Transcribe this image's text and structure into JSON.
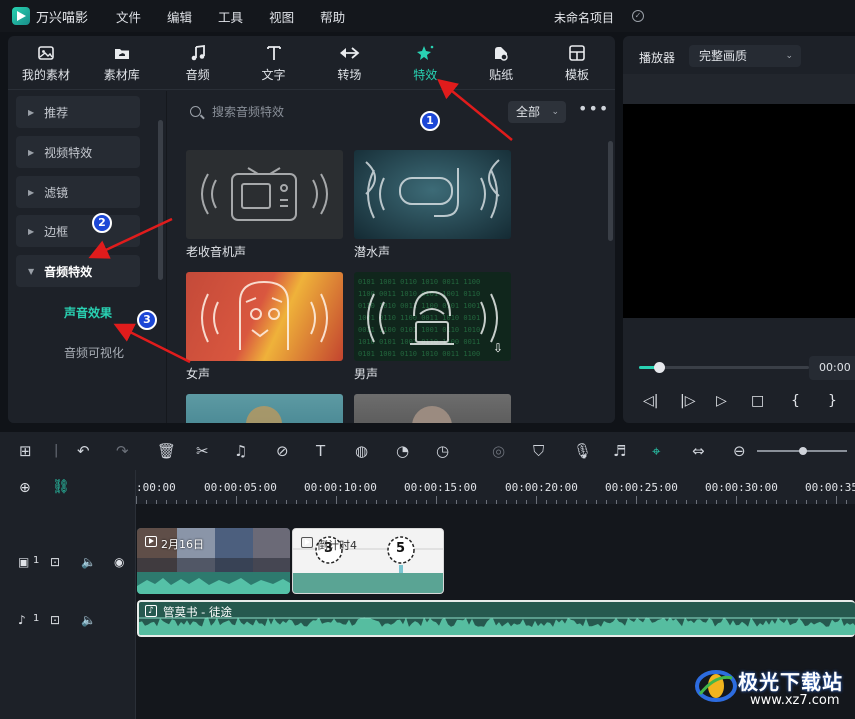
{
  "app": {
    "name": "万兴喵影",
    "project_name": "未命名项目"
  },
  "menu": [
    "文件",
    "编辑",
    "工具",
    "视图",
    "帮助"
  ],
  "tabs": [
    {
      "label": "我的素材",
      "icon": "image-icon"
    },
    {
      "label": "素材库",
      "icon": "cloud-folder-icon"
    },
    {
      "label": "音频",
      "icon": "music-note-icon"
    },
    {
      "label": "文字",
      "icon": "text-icon"
    },
    {
      "label": "转场",
      "icon": "transition-icon"
    },
    {
      "label": "特效",
      "icon": "sparkle-icon",
      "active": true
    },
    {
      "label": "贴纸",
      "icon": "sticker-icon"
    },
    {
      "label": "模板",
      "icon": "template-icon"
    }
  ],
  "sidebar": {
    "categories": [
      "推荐",
      "视频特效",
      "滤镜",
      "边框",
      "音频特效"
    ],
    "subcategories": [
      "声音效果",
      "音频可视化"
    ]
  },
  "search": {
    "placeholder": "搜索音频特效",
    "filter": "全部"
  },
  "effects": [
    {
      "label": "老收音机声",
      "icon": "tv-icon"
    },
    {
      "label": "潜水声",
      "icon": "snorkel-mask-icon"
    },
    {
      "label": "女声",
      "icon": "female-face-icon"
    },
    {
      "label": "男声",
      "icon": "hacker-icon"
    },
    {
      "label": "",
      "icon": "thumbnail-preview"
    },
    {
      "label": "",
      "icon": "thumbnail-preview"
    }
  ],
  "player": {
    "title": "播放器",
    "quality": "完整画质",
    "time": "00:00",
    "progress": 0.12
  },
  "timeline": {
    "ruler": [
      ":00:00",
      "00:00:05:00",
      "00:00:10:00",
      "00:00:15:00",
      "00:00:20:00",
      "00:00:25:00",
      "00:00:30:00",
      "00:00:35"
    ],
    "video_clips": [
      "2月16日",
      "倒计时4"
    ],
    "video_track_label": "1",
    "audio_track_label": "1",
    "audio_clip": "管莫书 - 徒途",
    "countdown_digits": [
      "3",
      "5"
    ]
  },
  "annotations": [
    "1",
    "2",
    "3"
  ],
  "watermark": {
    "title": "极光下载站",
    "url": "www.xz7.com"
  },
  "colors": {
    "accent": "#29d2b3",
    "annotation_arrow": "#e01c1c",
    "annotation_circle": "#1c47d6"
  }
}
